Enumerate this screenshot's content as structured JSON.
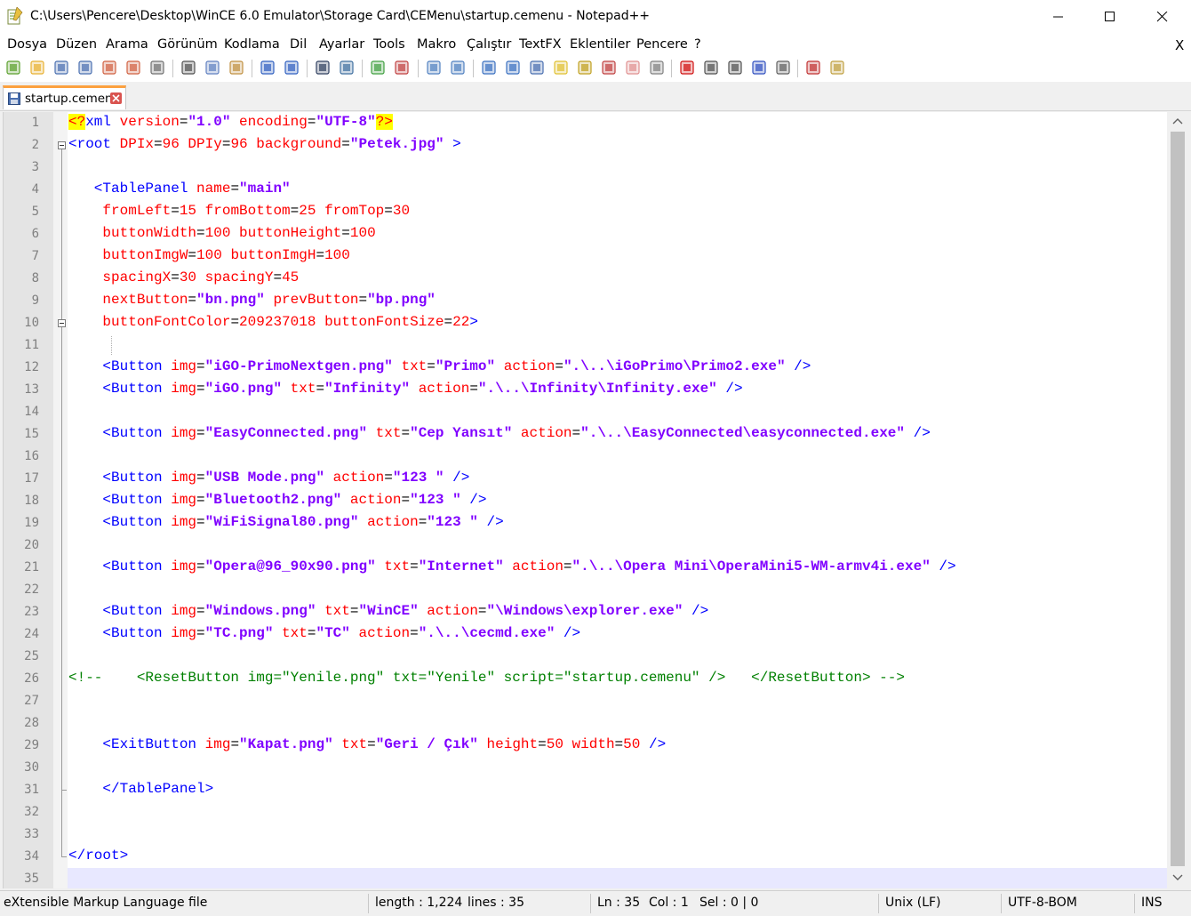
{
  "window": {
    "title": "C:\\Users\\Pencere\\Desktop\\WinCE 6.0 Emulator\\Storage Card\\CEMenu\\startup.cemenu - Notepad++",
    "icon": "notepad-icon",
    "controls": [
      "minimize-icon",
      "maximize-icon",
      "close-icon"
    ]
  },
  "menu": {
    "items": [
      "Dosya",
      "Düzen",
      "Arama",
      "Görünüm",
      "Kodlama",
      "Dil",
      "Ayarlar",
      "Tools",
      "Makro",
      "Çalıştır",
      "TextFX",
      "Eklentiler",
      "Pencere",
      "?"
    ],
    "close_label": "X"
  },
  "toolbar": {
    "icons": [
      "new-file-icon",
      "open-file-icon",
      "save-icon",
      "save-all-icon",
      "close-file-icon",
      "close-all-icon",
      "print-icon",
      "cut-icon",
      "copy-icon",
      "paste-icon",
      "undo-icon",
      "redo-icon",
      "find-icon",
      "replace-icon",
      "zoom-in-icon",
      "zoom-out-icon",
      "sync-vertical-icon",
      "sync-horizontal-icon",
      "word-wrap-icon",
      "show-all-chars-icon",
      "indent-guide-icon",
      "udl-icon",
      "doc-map-icon",
      "function-list-icon",
      "folder-workspace-icon",
      "monitor-icon",
      "record-macro-icon",
      "stop-macro-icon",
      "play-macro-icon",
      "run-macro-multiple-icon",
      "save-macro-icon",
      "spell-check-icon",
      "plugin-icon"
    ]
  },
  "tab": {
    "label": "startup.cemenu",
    "icon": "save-icon",
    "close_icon": "close-tab-icon"
  },
  "editor": {
    "current_line": 35,
    "lines": [
      [
        [
          "t-pi",
          "<?"
        ],
        [
          "t-tag",
          "xml "
        ],
        [
          "t-attr",
          "version"
        ],
        [
          "t-eq",
          "="
        ],
        [
          "t-val",
          "\"1.0\""
        ],
        [
          "t-attr",
          " encoding"
        ],
        [
          "t-eq",
          "="
        ],
        [
          "t-val",
          "\"UTF-8\""
        ],
        [
          "t-pi",
          "?>"
        ]
      ],
      [
        [
          "t-tag",
          "<root "
        ],
        [
          "t-attr",
          "DPIx"
        ],
        [
          "t-eq",
          "="
        ],
        [
          "t-num",
          "96"
        ],
        [
          "t-attr",
          " DPIy"
        ],
        [
          "t-eq",
          "="
        ],
        [
          "t-num",
          "96"
        ],
        [
          "t-attr",
          " background"
        ],
        [
          "t-eq",
          "="
        ],
        [
          "t-val",
          "\"Petek.jpg\""
        ],
        [
          "t-tag",
          " >"
        ]
      ],
      [],
      [
        [
          "t-tag",
          "   <TablePanel "
        ],
        [
          "t-attr",
          "name"
        ],
        [
          "t-eq",
          "="
        ],
        [
          "t-val",
          "\"main\""
        ]
      ],
      [
        [
          "t-attr",
          "    fromLeft"
        ],
        [
          "t-eq",
          "="
        ],
        [
          "t-num",
          "15"
        ],
        [
          "t-attr",
          " fromBottom"
        ],
        [
          "t-eq",
          "="
        ],
        [
          "t-num",
          "25"
        ],
        [
          "t-attr",
          " fromTop"
        ],
        [
          "t-eq",
          "="
        ],
        [
          "t-num",
          "30"
        ]
      ],
      [
        [
          "t-attr",
          "    buttonWidth"
        ],
        [
          "t-eq",
          "="
        ],
        [
          "t-num",
          "100"
        ],
        [
          "t-attr",
          " buttonHeight"
        ],
        [
          "t-eq",
          "="
        ],
        [
          "t-num",
          "100"
        ]
      ],
      [
        [
          "t-attr",
          "    buttonImgW"
        ],
        [
          "t-eq",
          "="
        ],
        [
          "t-num",
          "100"
        ],
        [
          "t-attr",
          " buttonImgH"
        ],
        [
          "t-eq",
          "="
        ],
        [
          "t-num",
          "100"
        ]
      ],
      [
        [
          "t-attr",
          "    spacingX"
        ],
        [
          "t-eq",
          "="
        ],
        [
          "t-num",
          "30"
        ],
        [
          "t-attr",
          " spacingY"
        ],
        [
          "t-eq",
          "="
        ],
        [
          "t-num",
          "45"
        ]
      ],
      [
        [
          "t-attr",
          "    nextButton"
        ],
        [
          "t-eq",
          "="
        ],
        [
          "t-val",
          "\"bn.png\""
        ],
        [
          "t-attr",
          " prevButton"
        ],
        [
          "t-eq",
          "="
        ],
        [
          "t-val",
          "\"bp.png\""
        ]
      ],
      [
        [
          "t-attr",
          "    buttonFontColor"
        ],
        [
          "t-eq",
          "="
        ],
        [
          "t-num",
          "209237018"
        ],
        [
          "t-attr",
          " buttonFontSize"
        ],
        [
          "t-eq",
          "="
        ],
        [
          "t-num",
          "22"
        ],
        [
          "t-tag",
          ">"
        ]
      ],
      [],
      [
        [
          "t-tag",
          "    <Button "
        ],
        [
          "t-attr",
          "img"
        ],
        [
          "t-eq",
          "="
        ],
        [
          "t-val",
          "\"iGO-PrimoNextgen.png\""
        ],
        [
          "t-attr",
          " txt"
        ],
        [
          "t-eq",
          "="
        ],
        [
          "t-val",
          "\"Primo\""
        ],
        [
          "t-attr",
          " action"
        ],
        [
          "t-eq",
          "="
        ],
        [
          "t-val",
          "\".\\..\\iGoPrimo\\Primo2.exe\""
        ],
        [
          "t-tag",
          " />"
        ]
      ],
      [
        [
          "t-tag",
          "    <Button "
        ],
        [
          "t-attr",
          "img"
        ],
        [
          "t-eq",
          "="
        ],
        [
          "t-val",
          "\"iGO.png\""
        ],
        [
          "t-attr",
          " txt"
        ],
        [
          "t-eq",
          "="
        ],
        [
          "t-val",
          "\"Infinity\""
        ],
        [
          "t-attr",
          " action"
        ],
        [
          "t-eq",
          "="
        ],
        [
          "t-val",
          "\".\\..\\Infinity\\Infinity.exe\""
        ],
        [
          "t-tag",
          " />"
        ]
      ],
      [],
      [
        [
          "t-tag",
          "    <Button "
        ],
        [
          "t-attr",
          "img"
        ],
        [
          "t-eq",
          "="
        ],
        [
          "t-val",
          "\"EasyConnected.png\""
        ],
        [
          "t-attr",
          " txt"
        ],
        [
          "t-eq",
          "="
        ],
        [
          "t-val",
          "\"Cep Yansıt\""
        ],
        [
          "t-attr",
          " action"
        ],
        [
          "t-eq",
          "="
        ],
        [
          "t-val",
          "\".\\..\\EasyConnected\\easyconnected.exe\""
        ],
        [
          "t-tag",
          " />"
        ]
      ],
      [],
      [
        [
          "t-tag",
          "    <Button "
        ],
        [
          "t-attr",
          "img"
        ],
        [
          "t-eq",
          "="
        ],
        [
          "t-val",
          "\"USB Mode.png\""
        ],
        [
          "t-attr",
          " action"
        ],
        [
          "t-eq",
          "="
        ],
        [
          "t-val",
          "\"123 \""
        ],
        [
          "t-tag",
          " />"
        ]
      ],
      [
        [
          "t-tag",
          "    <Button "
        ],
        [
          "t-attr",
          "img"
        ],
        [
          "t-eq",
          "="
        ],
        [
          "t-val",
          "\"Bluetooth2.png\""
        ],
        [
          "t-attr",
          " action"
        ],
        [
          "t-eq",
          "="
        ],
        [
          "t-val",
          "\"123 \""
        ],
        [
          "t-tag",
          " />"
        ]
      ],
      [
        [
          "t-tag",
          "    <Button "
        ],
        [
          "t-attr",
          "img"
        ],
        [
          "t-eq",
          "="
        ],
        [
          "t-val",
          "\"WiFiSignal80.png\""
        ],
        [
          "t-attr",
          " action"
        ],
        [
          "t-eq",
          "="
        ],
        [
          "t-val",
          "\"123 \""
        ],
        [
          "t-tag",
          " />"
        ]
      ],
      [],
      [
        [
          "t-tag",
          "    <Button "
        ],
        [
          "t-attr",
          "img"
        ],
        [
          "t-eq",
          "="
        ],
        [
          "t-val",
          "\"Opera@96_90x90.png\""
        ],
        [
          "t-attr",
          " txt"
        ],
        [
          "t-eq",
          "="
        ],
        [
          "t-val",
          "\"Internet\""
        ],
        [
          "t-attr",
          " action"
        ],
        [
          "t-eq",
          "="
        ],
        [
          "t-val",
          "\".\\..\\Opera Mini\\OperaMini5-WM-armv4i.exe\""
        ],
        [
          "t-tag",
          " />"
        ]
      ],
      [],
      [
        [
          "t-tag",
          "    <Button "
        ],
        [
          "t-attr",
          "img"
        ],
        [
          "t-eq",
          "="
        ],
        [
          "t-val",
          "\"Windows.png\""
        ],
        [
          "t-attr",
          " txt"
        ],
        [
          "t-eq",
          "="
        ],
        [
          "t-val",
          "\"WinCE\""
        ],
        [
          "t-attr",
          " action"
        ],
        [
          "t-eq",
          "="
        ],
        [
          "t-val",
          "\"\\Windows\\explorer.exe\""
        ],
        [
          "t-tag",
          " />"
        ]
      ],
      [
        [
          "t-tag",
          "    <Button "
        ],
        [
          "t-attr",
          "img"
        ],
        [
          "t-eq",
          "="
        ],
        [
          "t-val",
          "\"TC.png\""
        ],
        [
          "t-attr",
          " txt"
        ],
        [
          "t-eq",
          "="
        ],
        [
          "t-val",
          "\"TC\""
        ],
        [
          "t-attr",
          " action"
        ],
        [
          "t-eq",
          "="
        ],
        [
          "t-val",
          "\".\\..\\cecmd.exe\""
        ],
        [
          "t-tag",
          " />"
        ]
      ],
      [],
      [
        [
          "t-cmt",
          "<!--    <ResetButton img=\"Yenile.png\" txt=\"Yenile\" script=\"startup.cemenu\" />   </ResetButton> -->"
        ]
      ],
      [],
      [],
      [
        [
          "t-tag",
          "    <ExitButton "
        ],
        [
          "t-attr",
          "img"
        ],
        [
          "t-eq",
          "="
        ],
        [
          "t-val",
          "\"Kapat.png\""
        ],
        [
          "t-attr",
          " txt"
        ],
        [
          "t-eq",
          "="
        ],
        [
          "t-val",
          "\"Geri / Çık\""
        ],
        [
          "t-attr",
          " height"
        ],
        [
          "t-eq",
          "="
        ],
        [
          "t-num",
          "50"
        ],
        [
          "t-attr",
          " width"
        ],
        [
          "t-eq",
          "="
        ],
        [
          "t-num",
          "50"
        ],
        [
          "t-tag",
          " />"
        ]
      ],
      [],
      [
        [
          "t-tag",
          "    </TablePanel>"
        ]
      ],
      [],
      [],
      [
        [
          "t-tag",
          "</root>"
        ]
      ],
      []
    ]
  },
  "status": {
    "file_type": "eXtensible Markup Language file",
    "length": "length : 1,224",
    "lines": "lines : 35",
    "ln": "Ln : 35",
    "col": "Col : 1",
    "sel": "Sel : 0 | 0",
    "eol": "Unix (LF)",
    "encoding": "UTF-8-BOM",
    "mode": "INS"
  }
}
